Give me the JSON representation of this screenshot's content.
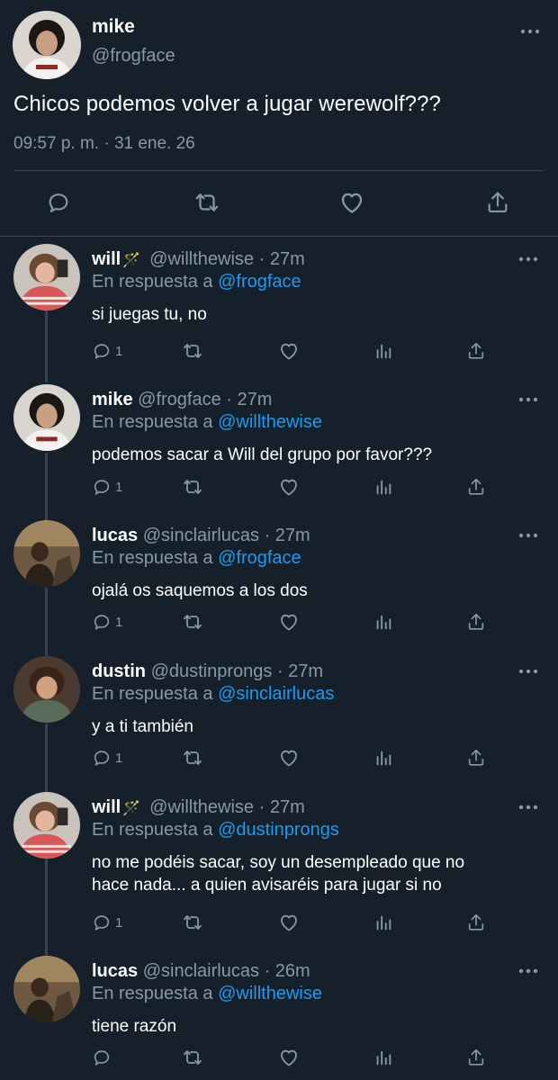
{
  "main_tweet": {
    "name": "mike",
    "handle": "@frogface",
    "text": "Chicos podemos volver a jugar werewolf???",
    "timestamp": "09:57 p. m. · 31 ene. 26",
    "avatar_icon": "avatar-mike",
    "actions": [
      "reply-icon",
      "retweet-icon",
      "like-icon",
      "share-icon"
    ]
  },
  "replies": [
    {
      "name": "will",
      "has_wand": true,
      "handle_time": "@willthewise · 27m",
      "replying_prefix": "En respuesta a",
      "replying_to": "@frogface",
      "text_lines": [
        "si juegas tu, no"
      ],
      "reply_count": "1"
    },
    {
      "name": "mike",
      "has_wand": false,
      "handle_time": "@frogface · 27m",
      "replying_prefix": "En respuesta a",
      "replying_to": "@willthewise",
      "text_lines": [
        "podemos sacar a Will del grupo por favor???"
      ],
      "reply_count": "1"
    },
    {
      "name": "lucas",
      "has_wand": false,
      "handle_time": "@sinclairlucas · 27m",
      "replying_prefix": "En respuesta a",
      "replying_to": "@frogface",
      "text_lines": [
        "ojalá os saquemos a los dos"
      ],
      "reply_count": "1"
    },
    {
      "name": "dustin",
      "has_wand": false,
      "handle_time": "@dustinprongs · 27m",
      "replying_prefix": "En respuesta a",
      "replying_to": "@sinclairlucas",
      "text_lines": [
        "y a ti también"
      ],
      "reply_count": "1"
    },
    {
      "name": "will",
      "has_wand": true,
      "handle_time": "@willthewise · 27m",
      "replying_prefix": "En respuesta a",
      "replying_to": "@dustinprongs",
      "text_lines": [
        "no me podéis sacar, soy un desempleado que no",
        "hace nada... a quien avisaréis para jugar si no"
      ],
      "reply_count": "1"
    },
    {
      "name": "lucas",
      "has_wand": false,
      "handle_time": "@sinclairlucas · 26m",
      "replying_prefix": "En respuesta a",
      "replying_to": "@willthewise",
      "text_lines": [
        "tiene razón"
      ],
      "reply_count": ""
    }
  ],
  "colors": {
    "background": "#15202b",
    "secondary_text": "#8899a6",
    "link": "#1d9bf0",
    "divider": "#38444d"
  },
  "icons": {
    "wand": "🪄",
    "more": "more-dots-icon",
    "reply": "reply-icon",
    "retweet": "retweet-icon",
    "like": "like-icon",
    "analytics": "analytics-icon",
    "share": "share-icon"
  }
}
